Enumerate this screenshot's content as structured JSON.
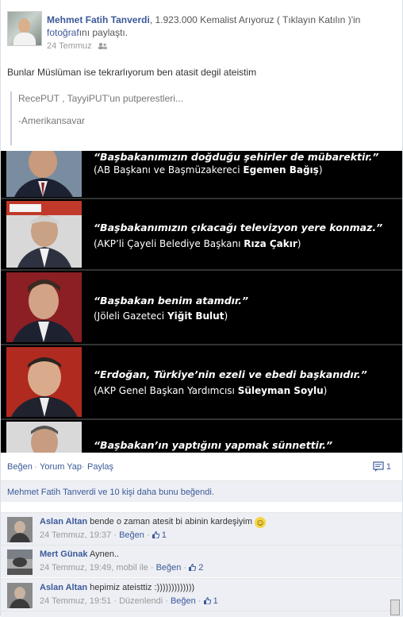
{
  "post": {
    "author": "Mehmet Fatih Tanverdi",
    "header_rest_1": ", 1.923.000 Kemalist Arıyoruz ( Tıklayın Katılın )'in",
    "header_link_2": "fotoğraf",
    "header_rest_2": "ını paylaştı.",
    "date": "24 Temmuz",
    "message": "Bunlar Müslüman ise tekrarlıyorum ben atasit degil ateistim",
    "quote_lines": [
      "RecePUT , TayyiPUT'un putperestleri...",
      "-Amerikansavar"
    ]
  },
  "photo": {
    "rows": [
      {
        "quote": "“Başbakanımızın doğduğu şehirler de mübarektir.”",
        "source_prefix": "(AB Başkanı ve Başmüzakereci ",
        "source_name": "Egemen Bağış",
        "source_suffix": ")"
      },
      {
        "quote": "“Başbakanımızın çıkacağı televizyon yere konmaz.”",
        "source_prefix": "(AKP’li Çayeli Belediye Başkanı ",
        "source_name": "Rıza Çakır",
        "source_suffix": ")"
      },
      {
        "quote": "“Başbakan benim atamdır.”",
        "source_prefix": "(Jöleli Gazeteci ",
        "source_name": "Yiğit Bulut",
        "source_suffix": ")"
      },
      {
        "quote": "“Erdoğan, Türkiye’nin ezeli ve ebedi başkanıdır.”",
        "source_prefix": "(AKP Genel Başkan Yardımcısı ",
        "source_name": "Süleyman Soylu",
        "source_suffix": ")"
      },
      {
        "quote": "“Başbakan’ın yaptığını yapmak sünnettir.”",
        "source_prefix": "",
        "source_name": "",
        "source_suffix": ""
      }
    ]
  },
  "actions": {
    "like": "Beğen",
    "comment": "Yorum Yap",
    "share": "Paylaş",
    "comment_count": "1"
  },
  "likes": {
    "text": "Mehmet Fatih Tanverdi ve 10 kişi daha bunu beğendi."
  },
  "comments": [
    {
      "name": "Aslan Altan",
      "text": "bende o zaman atesit bi abinin kardeşiyim",
      "emoji": "☺",
      "time": "24 Temmuz, 19:37",
      "extra": "",
      "like_label": "Beğen",
      "likes": "1"
    },
    {
      "name": "Mert Günak",
      "text": "Aynen..",
      "emoji": "",
      "time": "24 Temmuz, 19:49, mobil ile",
      "extra": "",
      "like_label": "Beğen",
      "likes": "2"
    },
    {
      "name": "Aslan Altan",
      "text": "hepimiz ateisttiz :)))))))))))))",
      "emoji": "",
      "time": "24 Temmuz, 19:51",
      "extra": "Düzenlendi",
      "like_label": "Beğen",
      "likes": "1"
    }
  ],
  "separators": {
    "dot": "·"
  }
}
